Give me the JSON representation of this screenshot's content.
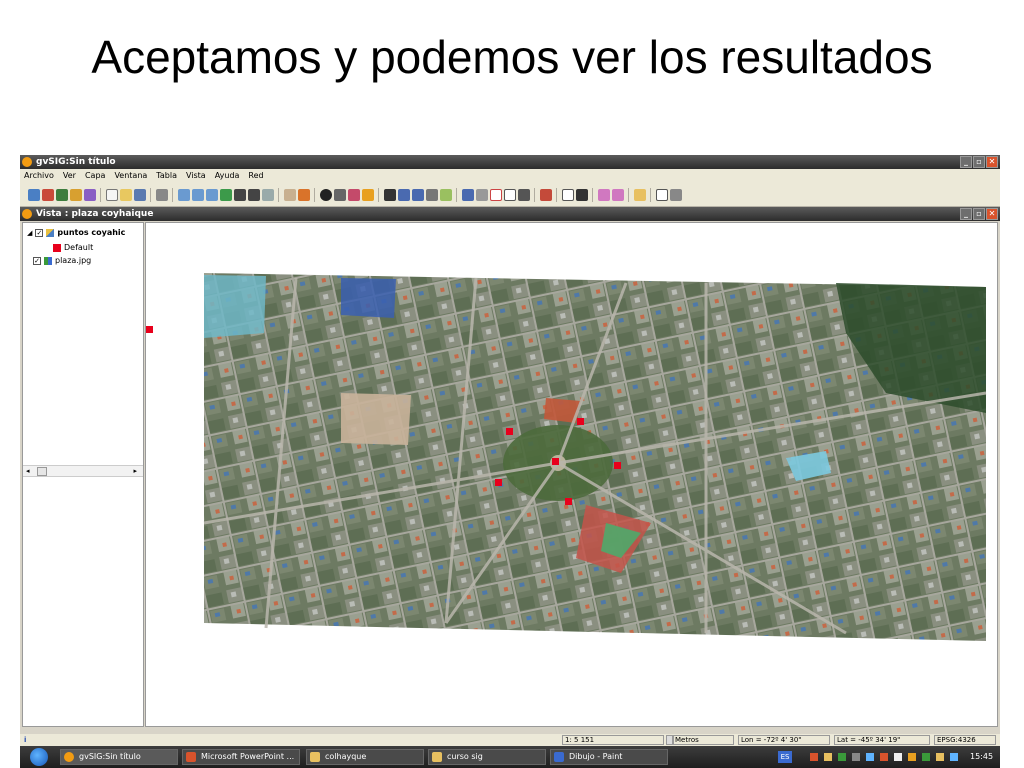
{
  "slide": {
    "title": "Aceptamos y podemos ver los resultados"
  },
  "app": {
    "title": "gvSIG:Sin título"
  },
  "menu": [
    "Archivo",
    "Ver",
    "Capa",
    "Ventana",
    "Tabla",
    "Vista",
    "Ayuda",
    "Red"
  ],
  "view": {
    "title": "Vista : plaza coyhaique"
  },
  "toc": {
    "layers": [
      {
        "name": "puntos coyahic",
        "legend": "Default"
      },
      {
        "name": "plaza.jpg"
      }
    ],
    "scroll_left": "◂",
    "scroll_right": "▸"
  },
  "status": {
    "info_icon": "i",
    "scale": "1: 5 151",
    "units": "Metros",
    "lon": "Lon = -72º 4' 30\"",
    "lat": "Lat = -45º 34' 19\"",
    "crs": "EPSG:4326"
  },
  "taskbar": {
    "tasks": [
      "gvSIG:Sin título",
      "Microsoft PowerPoint ...",
      "colhayque",
      "curso sig",
      "Dibujo - Paint"
    ],
    "lang": "ES",
    "clock": "15:45"
  },
  "colors": {
    "point": "#e8001c",
    "title_bar": "#3a3a3a",
    "accent": "#f39c12"
  }
}
